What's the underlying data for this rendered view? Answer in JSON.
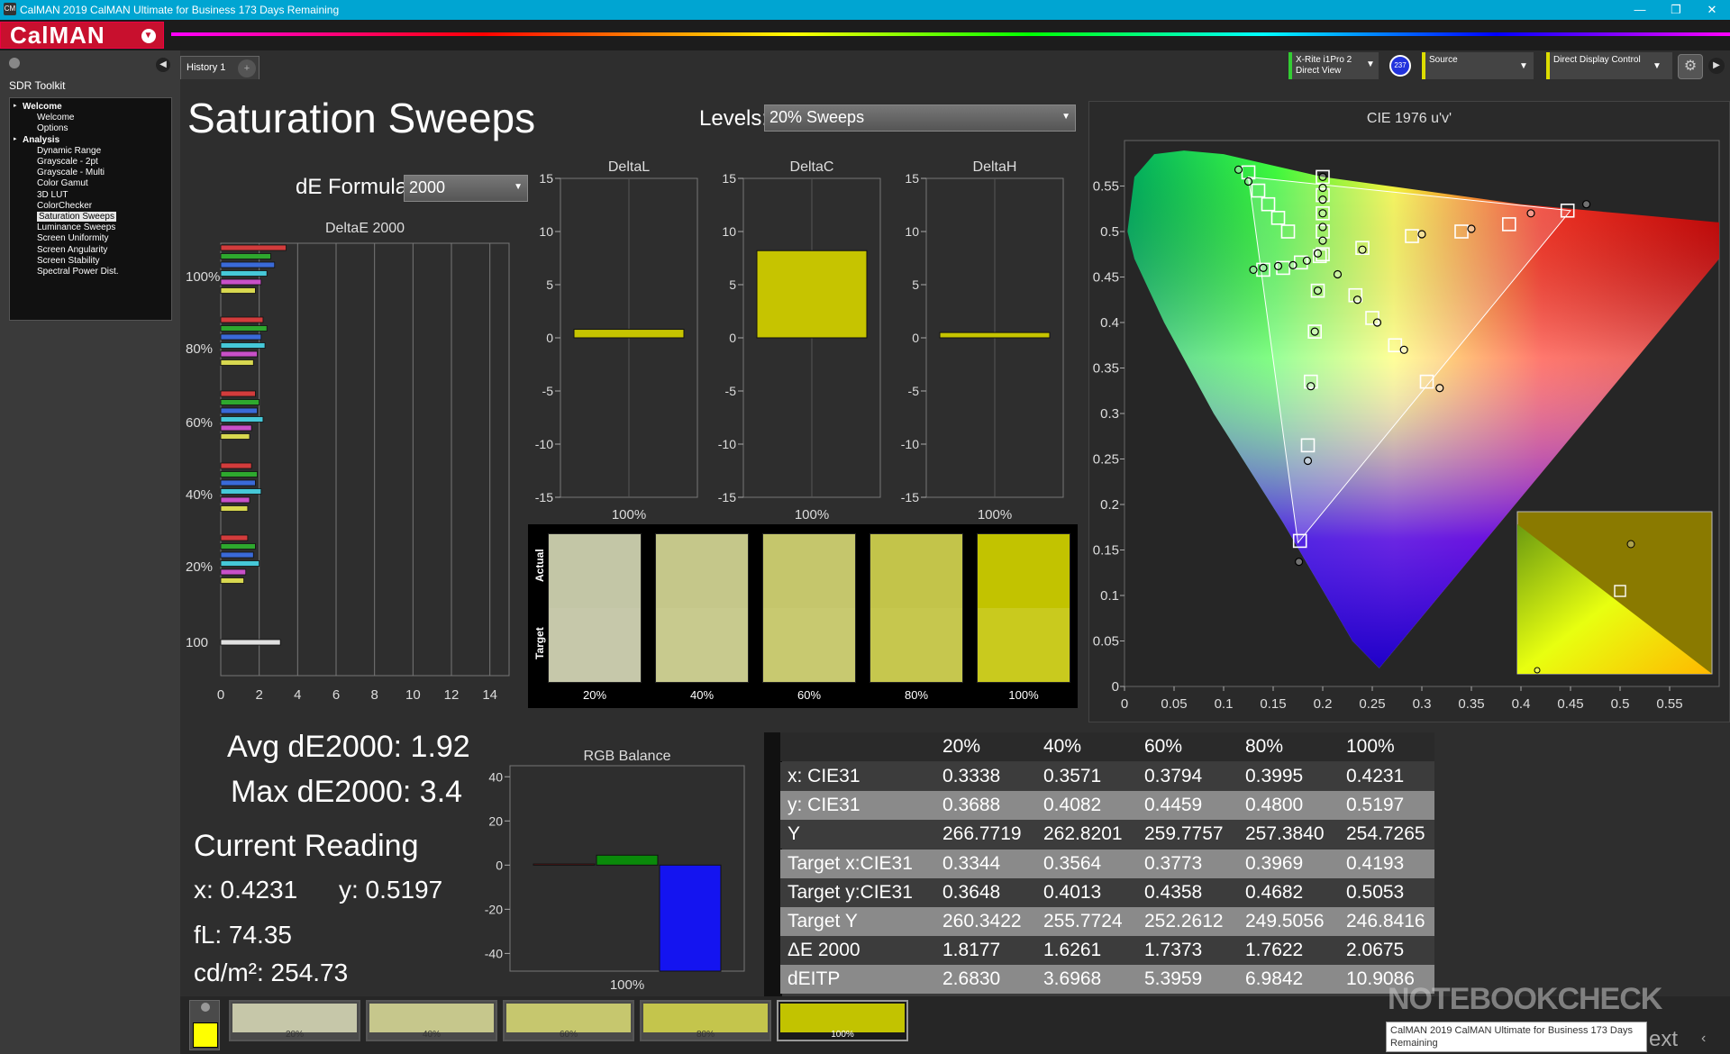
{
  "window": {
    "title": "CalMAN 2019 CalMAN Ultimate for Business 173 Days Remaining",
    "logo": "CalMAN",
    "minimize": "—",
    "maximize": "❐",
    "close": "✕"
  },
  "sidebar": {
    "title": "SDR Toolkit",
    "items": [
      {
        "label": "Welcome",
        "level": 0
      },
      {
        "label": "Welcome",
        "level": 1
      },
      {
        "label": "Options",
        "level": 1
      },
      {
        "label": "Analysis",
        "level": 0
      },
      {
        "label": "Dynamic Range",
        "level": 1
      },
      {
        "label": "Grayscale - 2pt",
        "level": 1
      },
      {
        "label": "Grayscale - Multi",
        "level": 1
      },
      {
        "label": "Color Gamut",
        "level": 1
      },
      {
        "label": "3D LUT",
        "level": 1
      },
      {
        "label": "ColorChecker",
        "level": 1
      },
      {
        "label": "Saturation Sweeps",
        "level": 1,
        "selected": true
      },
      {
        "label": "Luminance Sweeps",
        "level": 1
      },
      {
        "label": "Screen Uniformity",
        "level": 1
      },
      {
        "label": "Screen Angularity",
        "level": 1
      },
      {
        "label": "Screen Stability",
        "level": 1
      },
      {
        "label": "Spectral Power Dist.",
        "level": 1
      }
    ]
  },
  "tabs": {
    "history": "History 1",
    "add": "+"
  },
  "toolbar": {
    "meter_line1": "X-Rite i1Pro 2",
    "meter_line2": "Direct View",
    "badge": "237",
    "source": "Source",
    "display": "Direct Display Control"
  },
  "page": {
    "title": "Saturation Sweeps",
    "levels_label": "Levels:",
    "levels_value": "20% Sweeps",
    "formula_label": "dE Formula:",
    "formula_value": "2000"
  },
  "deltae_chart": {
    "title": "DeltaE 2000",
    "x_ticks": [
      "0",
      "2",
      "4",
      "6",
      "8",
      "10",
      "12",
      "14"
    ],
    "xlim": [
      0,
      15
    ],
    "groups": [
      {
        "label": "100%",
        "values": [
          3.4,
          2.6,
          2.8,
          2.4,
          2.1,
          1.8
        ]
      },
      {
        "label": "80%",
        "values": [
          2.2,
          2.4,
          2.1,
          2.3,
          1.9,
          1.7
        ]
      },
      {
        "label": "60%",
        "values": [
          1.8,
          2.0,
          1.9,
          2.2,
          1.6,
          1.5
        ]
      },
      {
        "label": "40%",
        "values": [
          1.6,
          1.9,
          1.8,
          2.1,
          1.5,
          1.4
        ]
      },
      {
        "label": "20%",
        "values": [
          1.4,
          1.8,
          1.7,
          2.0,
          1.3,
          1.2
        ]
      },
      {
        "label": "100",
        "values": [
          3.1
        ]
      }
    ],
    "colors": [
      "#d23c3c",
      "#2ea82e",
      "#3a6ad8",
      "#46c8d8",
      "#c850c8",
      "#d8d850"
    ]
  },
  "delta_charts": [
    {
      "title": "DeltaL",
      "value": 0.8,
      "x_label": "100%"
    },
    {
      "title": "DeltaC",
      "value": 8.2,
      "x_label": "100%"
    },
    {
      "title": "DeltaH",
      "value": 0.5,
      "x_label": "100%"
    }
  ],
  "delta_axis": {
    "ticks": [
      "15",
      "10",
      "5",
      "0",
      "-5",
      "-10",
      "-15"
    ],
    "ylim": [
      -15,
      15
    ]
  },
  "swatches": {
    "actual_label": "Actual",
    "target_label": "Target",
    "items": [
      {
        "label": "20%",
        "actual": "#c3c6a6",
        "target": "#c6c8aa"
      },
      {
        "label": "40%",
        "actual": "#c5c78a",
        "target": "#c8ca8e"
      },
      {
        "label": "60%",
        "actual": "#c5c66c",
        "target": "#c8c970"
      },
      {
        "label": "80%",
        "actual": "#c3c44a",
        "target": "#c6c74e"
      },
      {
        "label": "100%",
        "actual": "#c2c300",
        "target": "#c9ca1e"
      }
    ]
  },
  "stats": {
    "avg": "Avg dE2000: 1.92",
    "max": "Max dE2000: 3.4",
    "current_reading": "Current Reading",
    "x": "x: 0.4231",
    "y": "y: 0.5197",
    "fl": "fL: 74.35",
    "cdm2": "cd/m²: 254.73"
  },
  "rgb_balance": {
    "title": "RGB Balance",
    "ticks": [
      "40",
      "20",
      "0",
      "-20",
      "-40"
    ],
    "ylim": [
      -48,
      45
    ],
    "bars": [
      {
        "name": "red",
        "value": 0.5,
        "color": "#cc2222"
      },
      {
        "name": "green",
        "value": 4.5,
        "color": "#0a8a0a"
      },
      {
        "name": "blue",
        "value": -48,
        "color": "#1414f0"
      }
    ],
    "x_label": "100%"
  },
  "table": {
    "headers": [
      "",
      "20%",
      "40%",
      "60%",
      "80%",
      "100%"
    ],
    "rows": [
      [
        "x: CIE31",
        "0.3338",
        "0.3571",
        "0.3794",
        "0.3995",
        "0.4231"
      ],
      [
        "y: CIE31",
        "0.3688",
        "0.4082",
        "0.4459",
        "0.4800",
        "0.5197"
      ],
      [
        "Y",
        "266.7719",
        "262.8201",
        "259.7757",
        "257.3840",
        "254.7265"
      ],
      [
        "Target x:CIE31",
        "0.3344",
        "0.3564",
        "0.3773",
        "0.3969",
        "0.4193"
      ],
      [
        "Target y:CIE31",
        "0.3648",
        "0.4013",
        "0.4358",
        "0.4682",
        "0.5053"
      ],
      [
        "Target Y",
        "260.3422",
        "255.7724",
        "252.2612",
        "249.5056",
        "246.8416"
      ],
      [
        "ΔE 2000",
        "1.8177",
        "1.6261",
        "1.7373",
        "1.7622",
        "2.0675"
      ],
      [
        "dEITP",
        "2.6830",
        "3.6968",
        "5.3959",
        "6.9842",
        "10.9086"
      ]
    ]
  },
  "cie_chart": {
    "title": "CIE 1976 u'v'",
    "x_ticks": [
      "0",
      "0.05",
      "0.1",
      "0.15",
      "0.2",
      "0.25",
      "0.3",
      "0.35",
      "0.4",
      "0.45",
      "0.5",
      "0.55"
    ],
    "y_ticks": [
      "0.55",
      "0.5",
      "0.45",
      "0.4",
      "0.35",
      "0.3",
      "0.25",
      "0.2",
      "0.15",
      "0.1",
      "0.05",
      "0"
    ],
    "xlim": [
      0,
      0.6
    ],
    "ylim": [
      0,
      0.6
    ],
    "targets": [
      [
        0.125,
        0.565
      ],
      [
        0.135,
        0.545
      ],
      [
        0.145,
        0.53
      ],
      [
        0.155,
        0.515
      ],
      [
        0.165,
        0.5
      ],
      [
        0.2,
        0.56
      ],
      [
        0.2,
        0.54
      ],
      [
        0.2,
        0.52
      ],
      [
        0.2,
        0.5
      ],
      [
        0.2,
        0.475
      ],
      [
        0.197,
        0.473
      ],
      [
        0.24,
        0.482
      ],
      [
        0.29,
        0.495
      ],
      [
        0.34,
        0.5
      ],
      [
        0.388,
        0.508
      ],
      [
        0.447,
        0.523
      ],
      [
        0.195,
        0.435
      ],
      [
        0.192,
        0.39
      ],
      [
        0.188,
        0.335
      ],
      [
        0.185,
        0.265
      ],
      [
        0.177,
        0.16
      ],
      [
        0.233,
        0.43
      ],
      [
        0.25,
        0.405
      ],
      [
        0.273,
        0.375
      ],
      [
        0.305,
        0.335
      ],
      [
        0.14,
        0.458
      ],
      [
        0.16,
        0.46
      ],
      [
        0.178,
        0.466
      ]
    ],
    "actuals": [
      [
        0.115,
        0.568
      ],
      [
        0.125,
        0.555
      ],
      [
        0.2,
        0.56
      ],
      [
        0.2,
        0.548
      ],
      [
        0.2,
        0.535
      ],
      [
        0.2,
        0.52
      ],
      [
        0.2,
        0.505
      ],
      [
        0.2,
        0.49
      ],
      [
        0.195,
        0.476
      ],
      [
        0.24,
        0.48
      ],
      [
        0.3,
        0.497
      ],
      [
        0.35,
        0.503
      ],
      [
        0.41,
        0.52
      ],
      [
        0.466,
        0.53
      ],
      [
        0.215,
        0.453
      ],
      [
        0.235,
        0.425
      ],
      [
        0.255,
        0.4
      ],
      [
        0.282,
        0.37
      ],
      [
        0.318,
        0.328
      ],
      [
        0.195,
        0.435
      ],
      [
        0.192,
        0.39
      ],
      [
        0.188,
        0.33
      ],
      [
        0.185,
        0.248
      ],
      [
        0.176,
        0.137
      ],
      [
        0.13,
        0.458
      ],
      [
        0.14,
        0.46
      ],
      [
        0.155,
        0.462
      ],
      [
        0.17,
        0.463
      ],
      [
        0.184,
        0.468
      ]
    ]
  },
  "bottom_swatches": [
    {
      "label": "20%",
      "color": "#c6c7a9"
    },
    {
      "label": "40%",
      "color": "#c6c78c"
    },
    {
      "label": "60%",
      "color": "#c6c76e"
    },
    {
      "label": "80%",
      "color": "#c4c54c"
    },
    {
      "label": "100%",
      "color": "#c2c300"
    }
  ],
  "bottom": {
    "current_color": "#ffff00",
    "next": "ext",
    "nav": "‹",
    "watermark": "NOTEBOOKCHECK",
    "tooltip": "CalMAN 2019 CalMAN Ultimate for Business 173 Days Remaining"
  }
}
